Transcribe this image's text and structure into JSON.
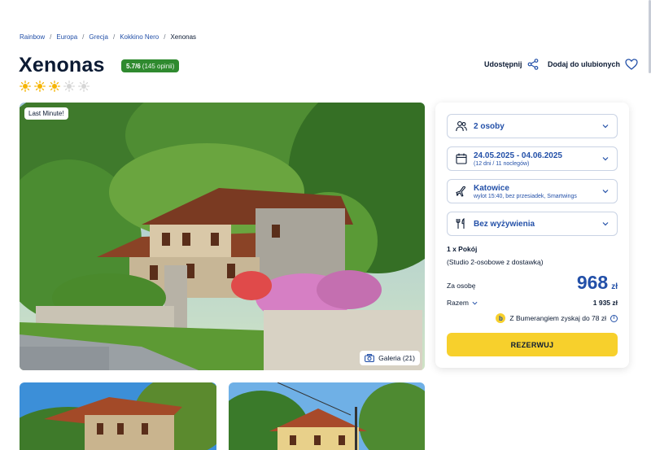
{
  "breadcrumb": [
    "Rainbow",
    "Europa",
    "Grecja",
    "Kokkino Nero",
    "Xenonas"
  ],
  "hotel": {
    "name": "Xenonas",
    "rating_score": "5.7/6",
    "rating_reviews": "(145 opinii)",
    "category_suns": 3,
    "category_max": 5
  },
  "actions": {
    "share": "Udostępnij",
    "favorite": "Dodaj do ulubionych"
  },
  "gallery": {
    "badge": "Last Minute!",
    "button": "Galeria (21)"
  },
  "booking": {
    "persons": "2 osoby",
    "dates": "24.05.2025 - 04.06.2025",
    "dates_sub": "(12 dni / 11 noclegów)",
    "departure": "Katowice",
    "departure_sub": "wylot 15:40, bez przesiadek, Smartwings",
    "board": "Bez wyżywienia",
    "room": "1 x Pokój",
    "room_desc": "(Studio 2-osobowe z dostawką)",
    "per_person_label": "Za osobę",
    "price": "968",
    "currency": "zł",
    "total_label": "Razem",
    "total_value": "1 935 zł",
    "bumerang_text": "Z Bumerangiem zyskaj do 78 zł",
    "reserve": "REZERWUJ"
  },
  "colors": {
    "accent_blue": "#2350a8",
    "rating_green": "#2f8a2f",
    "cta_yellow": "#f7d02c",
    "sun_active": "#f5b400",
    "sun_inactive": "#d6d6d6"
  }
}
